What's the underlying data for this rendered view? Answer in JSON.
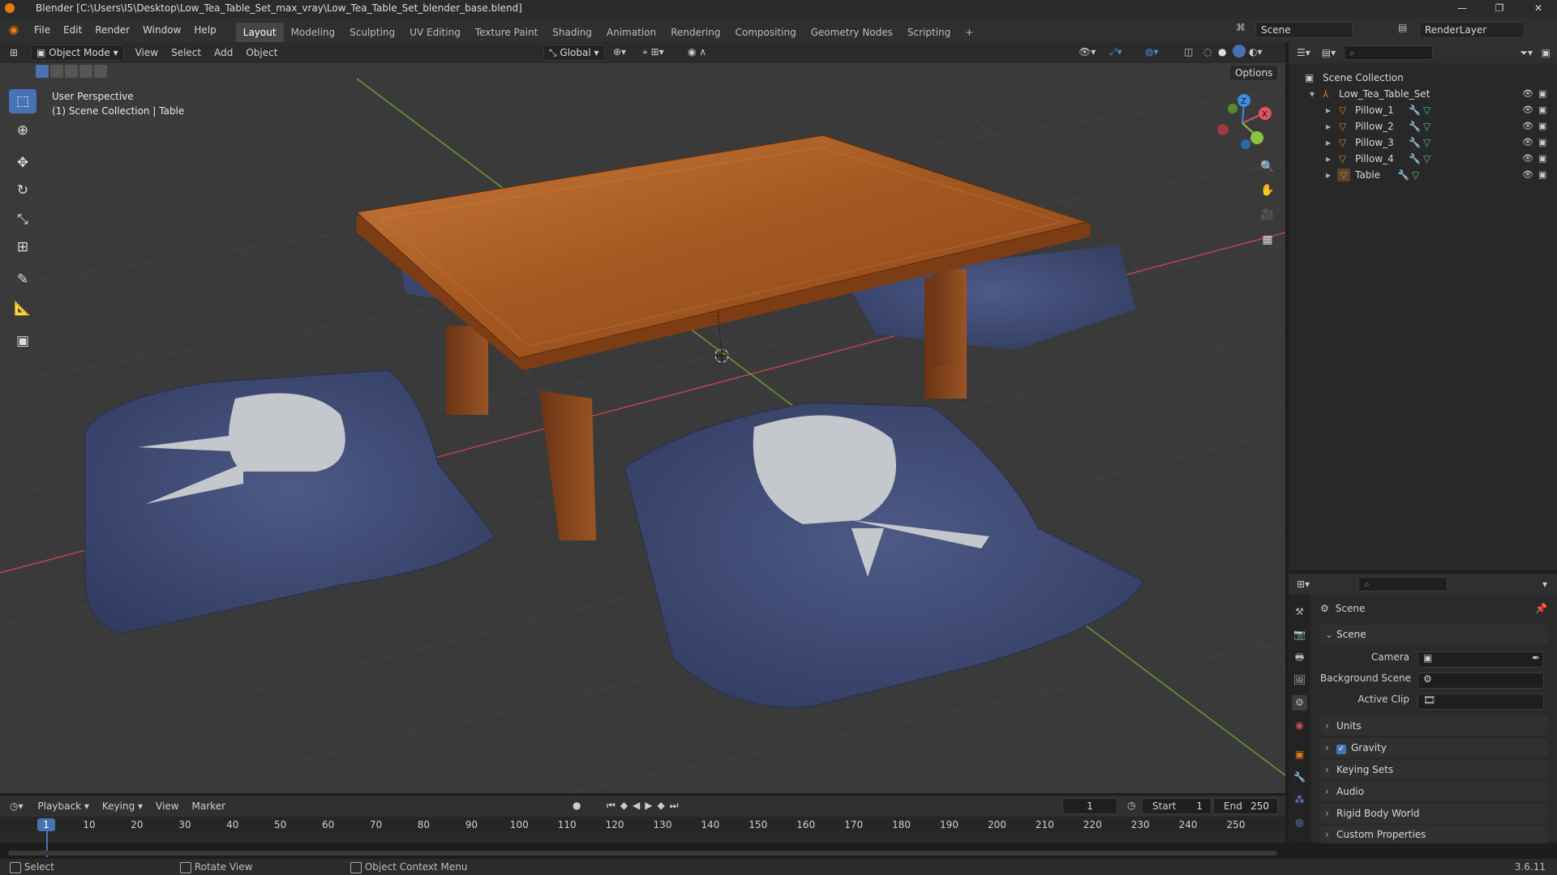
{
  "window": {
    "title": "Blender [C:\\Users\\I5\\Desktop\\Low_Tea_Table_Set_max_vray\\Low_Tea_Table_Set_blender_base.blend]",
    "controls": [
      "—",
      "❐",
      "✕"
    ]
  },
  "menubar": {
    "items": [
      "File",
      "Edit",
      "Render",
      "Window",
      "Help"
    ],
    "workspaces": [
      "Layout",
      "Modeling",
      "Sculpting",
      "UV Editing",
      "Texture Paint",
      "Shading",
      "Animation",
      "Rendering",
      "Compositing",
      "Geometry Nodes",
      "Scripting"
    ],
    "active_workspace": "Layout",
    "add_tab": "+",
    "scene": "Scene",
    "view_layer": "RenderLayer"
  },
  "viewport_header": {
    "mode": "Object Mode",
    "menus": [
      "View",
      "Select",
      "Add",
      "Object"
    ],
    "transform_orientation": "Global",
    "options": "Options"
  },
  "viewport": {
    "overlay_line1": "User Perspective",
    "overlay_line2": "(1) Scene Collection | Table",
    "gizmo_axes": [
      "Z",
      "X"
    ]
  },
  "tools": [
    "select-box",
    "cursor",
    "move",
    "rotate",
    "scale",
    "transform",
    "annotate",
    "measure",
    "add-cube"
  ],
  "outliner": {
    "root": "Scene Collection",
    "collection": "Low_Tea_Table_Set",
    "objects": [
      "Pillow_1",
      "Pillow_2",
      "Pillow_3",
      "Pillow_4",
      "Table"
    ]
  },
  "properties": {
    "context": "Scene",
    "panel_scene": "Scene",
    "fields": [
      {
        "label": "Camera",
        "value": ""
      },
      {
        "label": "Background Scene",
        "value": ""
      },
      {
        "label": "Active Clip",
        "value": ""
      }
    ],
    "sections": [
      "Units",
      "Gravity",
      "Keying Sets",
      "Audio",
      "Rigid Body World",
      "Custom Properties"
    ],
    "gravity_checked": true
  },
  "timeline": {
    "menus": [
      "Playback",
      "Keying",
      "View",
      "Marker"
    ],
    "current_frame": "1",
    "start_label": "Start",
    "start": "1",
    "end_label": "End",
    "end": "250",
    "ruler": [
      "1",
      "10",
      "20",
      "30",
      "40",
      "50",
      "60",
      "70",
      "80",
      "90",
      "100",
      "110",
      "120",
      "130",
      "140",
      "150",
      "160",
      "170",
      "180",
      "190",
      "200",
      "210",
      "220",
      "230",
      "240",
      "250"
    ]
  },
  "statusbar": {
    "select": "Select",
    "rotate": "Rotate View",
    "context_menu": "Object Context Menu",
    "version": "3.6.11"
  },
  "colors": {
    "accent": "#4772b3",
    "x_axis": "#e0545e",
    "y_axis": "#8ac43f",
    "z_axis": "#3b8ee0",
    "object_orange": "#e87d0d"
  }
}
